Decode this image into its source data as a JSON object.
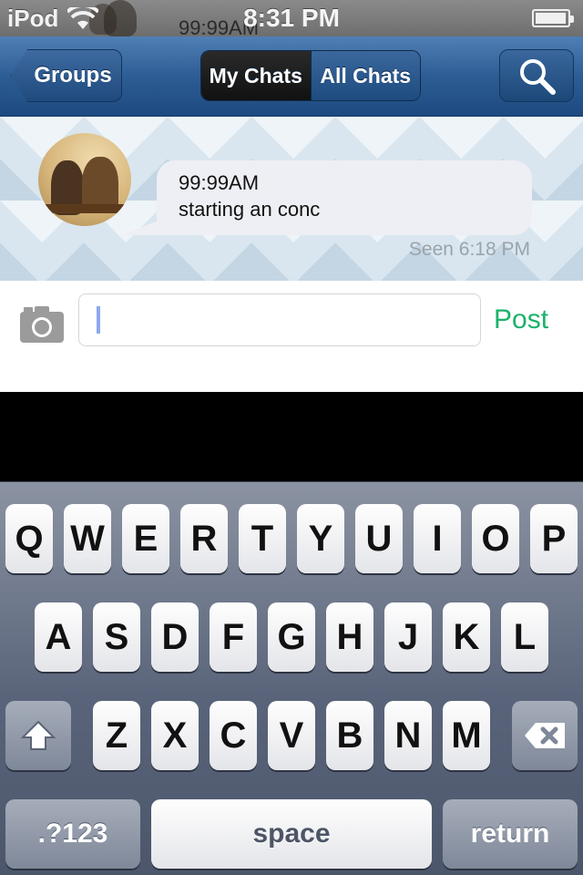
{
  "status_bar": {
    "carrier": "iPod",
    "time": "8:31 PM",
    "ghost_text": "99:99AM"
  },
  "nav": {
    "back_label": "Groups",
    "segments": [
      {
        "label": "My Chats",
        "selected": true
      },
      {
        "label": "All Chats",
        "selected": false
      }
    ],
    "search_icon": "search-icon"
  },
  "chat": {
    "message": {
      "time": "99:99AM",
      "text": "starting an conc",
      "status": "Seen 6:18 PM"
    }
  },
  "composer": {
    "camera_icon": "camera-icon",
    "input_value": "",
    "post_label": "Post",
    "post_color": "#1ab26b"
  },
  "keyboard": {
    "row1": [
      "Q",
      "W",
      "E",
      "R",
      "T",
      "Y",
      "U",
      "I",
      "O",
      "P"
    ],
    "row2": [
      "A",
      "S",
      "D",
      "F",
      "G",
      "H",
      "J",
      "K",
      "L"
    ],
    "row3": [
      "Z",
      "X",
      "C",
      "V",
      "B",
      "N",
      "M"
    ],
    "numbers_label": ".?123",
    "space_label": "space",
    "return_label": "return",
    "shift_icon": "shift-icon",
    "delete_icon": "backspace-icon"
  }
}
